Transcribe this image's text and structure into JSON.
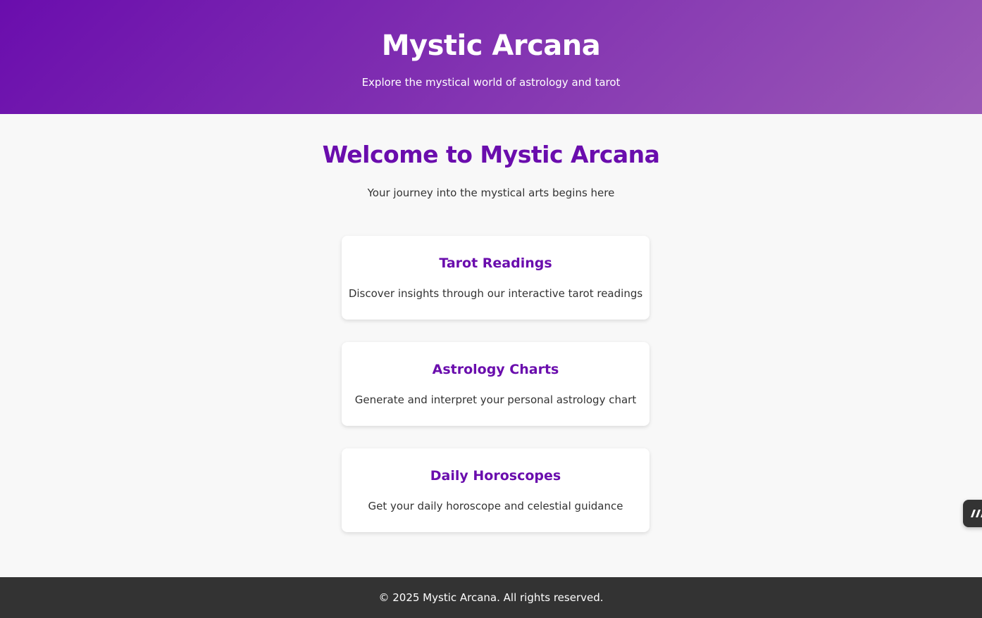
{
  "header": {
    "title": "Mystic Arcana",
    "tagline": "Explore the mystical world of astrology and tarot"
  },
  "main": {
    "welcome_title": "Welcome to Mystic Arcana",
    "welcome_subtitle": "Your journey into the mystical arts begins here",
    "cards": [
      {
        "title": "Tarot Readings",
        "description": "Discover insights through our interactive tarot readings"
      },
      {
        "title": "Astrology Charts",
        "description": "Generate and interpret your personal astrology chart"
      },
      {
        "title": "Daily Horoscopes",
        "description": "Get your daily horoscope and celestial guidance"
      }
    ]
  },
  "footer": {
    "copyright": "© 2025 Mystic Arcana. All rights reserved."
  },
  "widget": {
    "icon": "lovable-badge-icon"
  },
  "colors": {
    "accent": "#6a0dad",
    "header_gradient_start": "#6a0dad",
    "header_gradient_end": "#9b59b6",
    "footer_background": "#333333",
    "page_background": "#f8f8f8"
  }
}
